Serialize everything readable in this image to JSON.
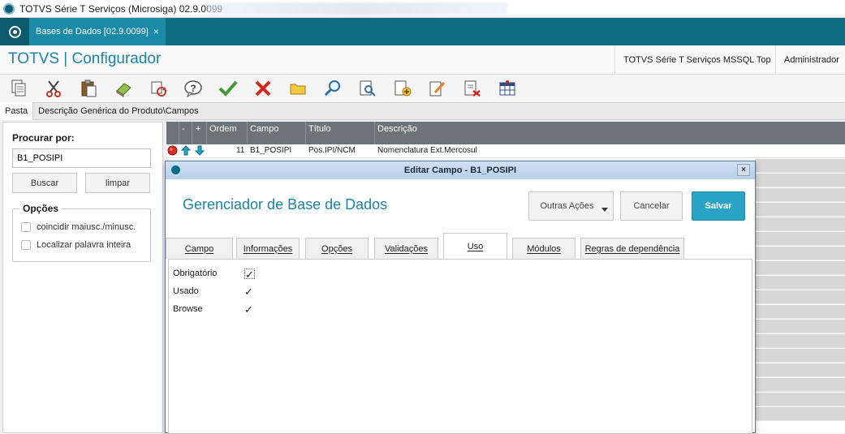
{
  "window": {
    "title": "TOTVS Série T Serviços (Microsiga) 02.9.0099"
  },
  "tab": {
    "label": "Bases de Dados [02.9.0099]",
    "close": "×"
  },
  "header": {
    "brand": "TOTVS | Configurador",
    "environment": "TOTVS Série T Serviços MSSQL Top",
    "user": "Administrador"
  },
  "toolbar": {
    "icons": [
      "copy-icon",
      "cut-icon",
      "paste-icon",
      "eraser-icon",
      "refresh-icon",
      "help-icon",
      "confirm-icon",
      "cancel-icon",
      "folder-icon",
      "search-icon",
      "preview-icon",
      "add-icon",
      "edit-icon",
      "delete-icon",
      "table-icon"
    ]
  },
  "path": {
    "pasta": "Pasta",
    "description": "Descrição Genérica do Produto\\Campos"
  },
  "left": {
    "search_label": "Procurar por:",
    "search_value": "B1_POSIPI",
    "buscar": "Buscar",
    "limpar": "limpar",
    "options_legend": "Opções",
    "opt1": "coincidir maiusc./minusc.",
    "opt2": "Localizar palavra inteira"
  },
  "grid": {
    "columns": [
      "-",
      "+",
      "Ordem",
      "Campo",
      "Título",
      "Descrição"
    ],
    "row": {
      "ordem": "11",
      "campo": "B1_POSIPI",
      "titulo": "Pos.IPI/NCM",
      "descricao": "Nomenclatura Ext.Mercosul"
    }
  },
  "modal": {
    "title": "Editar Campo - B1_POSIPI",
    "close": "×",
    "headline": "Gerenciador de Base de Dados",
    "outras": "Outras Ações",
    "cancelar": "Cancelar",
    "salvar": "Salvar",
    "tabs": [
      "Campo",
      "Informações",
      "Opções",
      "Validações",
      "Uso",
      "Módulos",
      "Regras de dependência"
    ],
    "fields": [
      {
        "label": "Obrigatório",
        "checked": true
      },
      {
        "label": "Usado",
        "checked": true
      },
      {
        "label": "Browse",
        "checked": true
      }
    ],
    "check_mark": "✓"
  },
  "colors": {
    "accent": "#1a85a8",
    "tabbar": "#0e6d85",
    "primary_button": "#29a3c6",
    "grid_header": "#6d7478"
  }
}
